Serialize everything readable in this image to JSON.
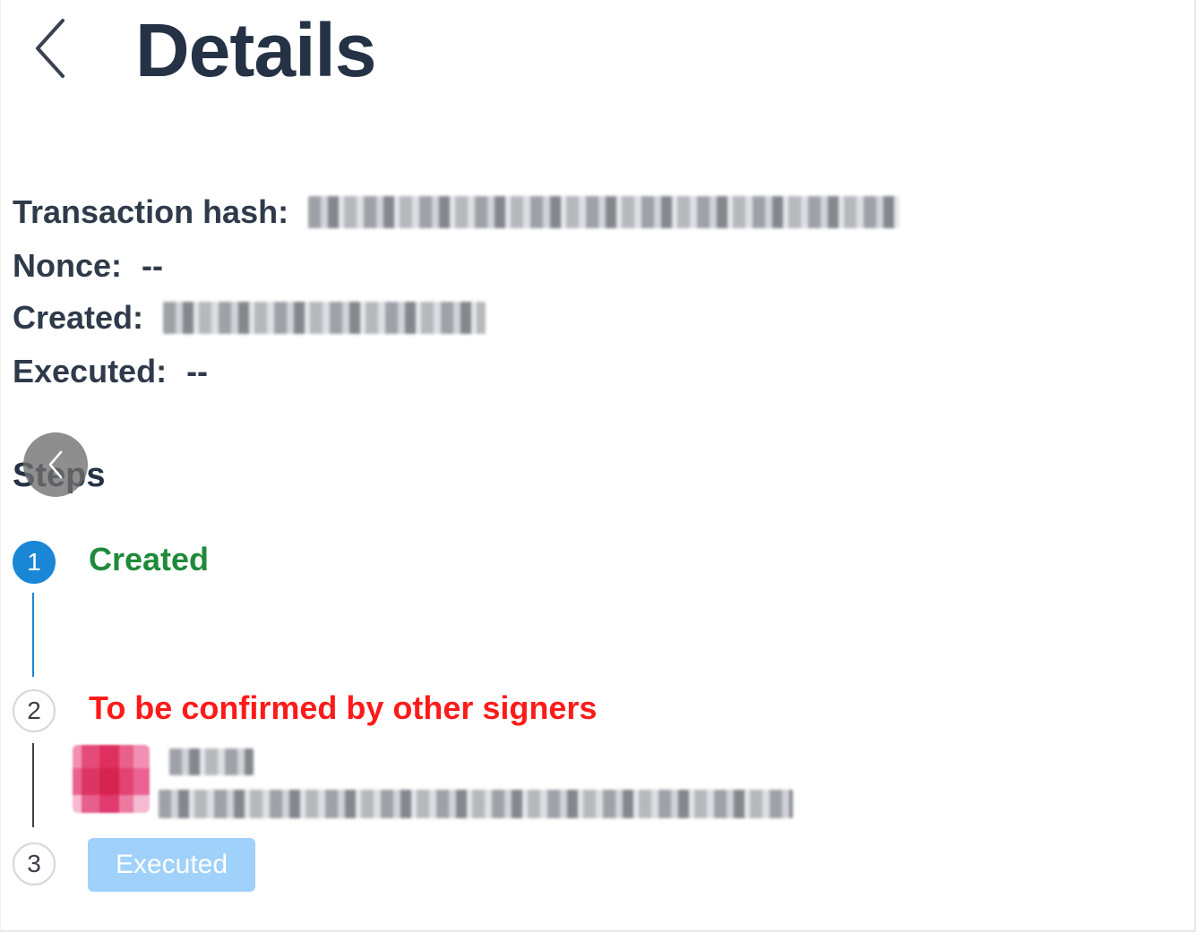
{
  "header": {
    "title": "Details",
    "back_icon": "chevron-left-icon"
  },
  "details": {
    "transaction_hash_label": "Transaction hash:",
    "transaction_hash_value": "",
    "nonce_label": "Nonce:",
    "nonce_value": "--",
    "created_label": "Created:",
    "created_value": "",
    "executed_label": "Executed:",
    "executed_value": "--"
  },
  "steps": {
    "title": "Steps",
    "items": [
      {
        "number": "1",
        "label": "Created",
        "state": "done",
        "color": "#1f8a3a"
      },
      {
        "number": "2",
        "label": "To be confirmed by other signers",
        "state": "pending",
        "color": "#ff1a1a"
      },
      {
        "number": "3",
        "label": "Executed",
        "state": "disabled"
      }
    ]
  },
  "overlay": {
    "floating_back_icon": "chevron-left-icon"
  },
  "colors": {
    "accent": "#1a86d6",
    "success": "#1f8a3a",
    "warning": "#ff1a1a",
    "disabled_button": "#9fd1fb"
  }
}
